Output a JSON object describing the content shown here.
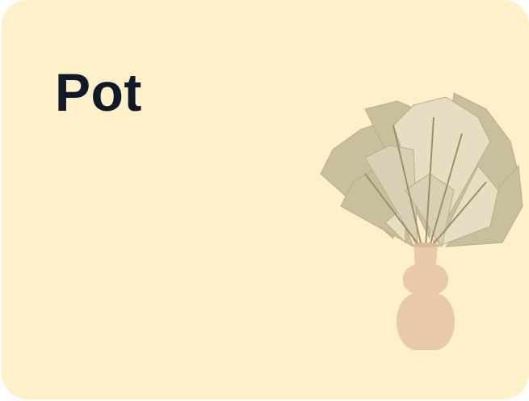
{
  "card": {
    "title": "Pot",
    "background_color": "#fef0c9",
    "title_color": "#111827",
    "image": "dried-palm-leaves-in-vase"
  }
}
